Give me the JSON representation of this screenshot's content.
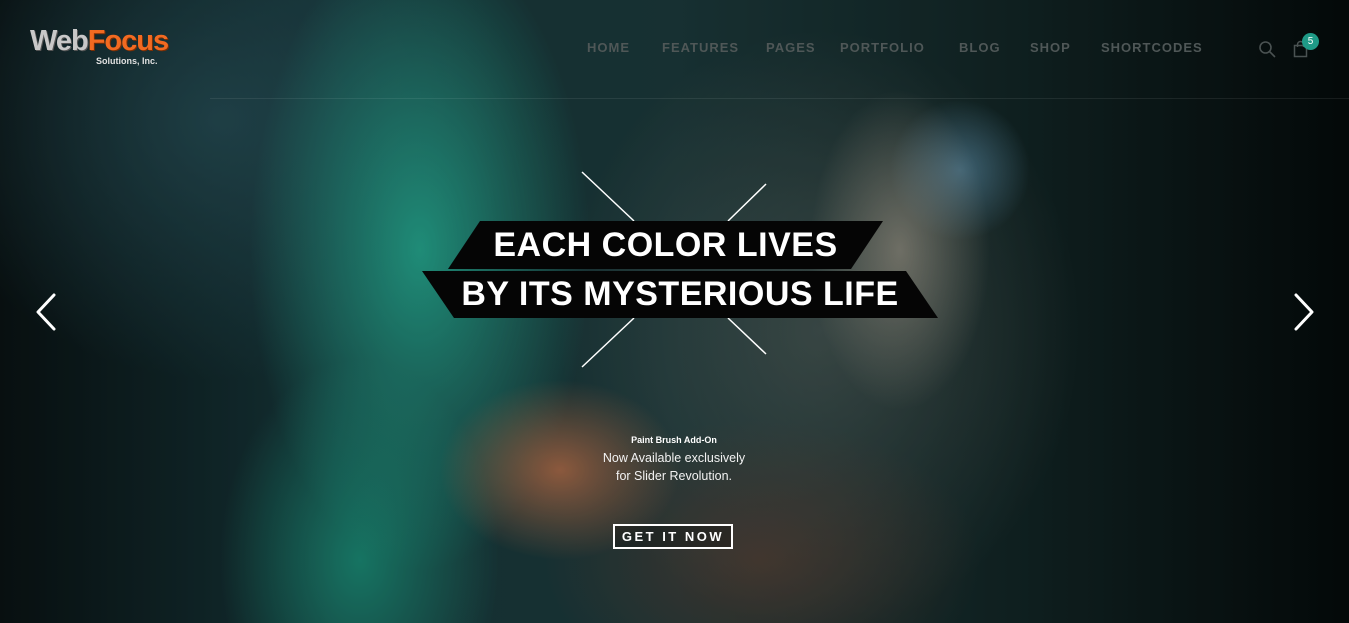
{
  "brand": {
    "name_part1": "Web",
    "name_part2": "Focus",
    "tagline": "Solutions, Inc."
  },
  "nav": {
    "items": [
      "HOME",
      "FEATURES",
      "PAGES",
      "PORTFOLIO",
      "BLOG",
      "SHOP",
      "SHORTCODES"
    ]
  },
  "cart": {
    "count": "5"
  },
  "icons": {
    "search": "search-icon",
    "cart": "shopping-bag-icon",
    "prev": "chevron-left-icon",
    "next": "chevron-right-icon"
  },
  "hero": {
    "title_line1": "EACH COLOR LIVES",
    "title_line2": "BY ITS MYSTERIOUS LIFE",
    "kicker": "Paint Brush Add-On",
    "text_line1": "Now Available exclusively",
    "text_line2": "for Slider Revolution.",
    "cta_label": "GET IT NOW"
  },
  "colors": {
    "accent": "#f26a21",
    "badge": "#1f9a87",
    "banner": "#050505",
    "nav_text": "#4f5757"
  }
}
